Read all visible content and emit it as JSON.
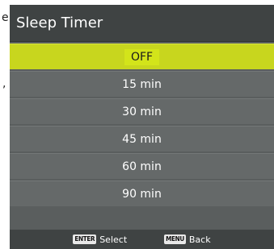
{
  "background": {
    "fragment_top": "e",
    "fragment_mid": ","
  },
  "sleep_timer": {
    "title": "Sleep Timer",
    "selected_index": 0,
    "options": [
      "OFF",
      "15 min",
      "30 min",
      "45 min",
      "60 min",
      "90 min"
    ]
  },
  "footer": {
    "enter_key": "ENTER",
    "enter_label": "Select",
    "menu_key": "MENU",
    "menu_label": "Back"
  },
  "colors": {
    "panel": "#5a5e5e",
    "header": "#3f4343",
    "selected": "#c8d61e"
  }
}
